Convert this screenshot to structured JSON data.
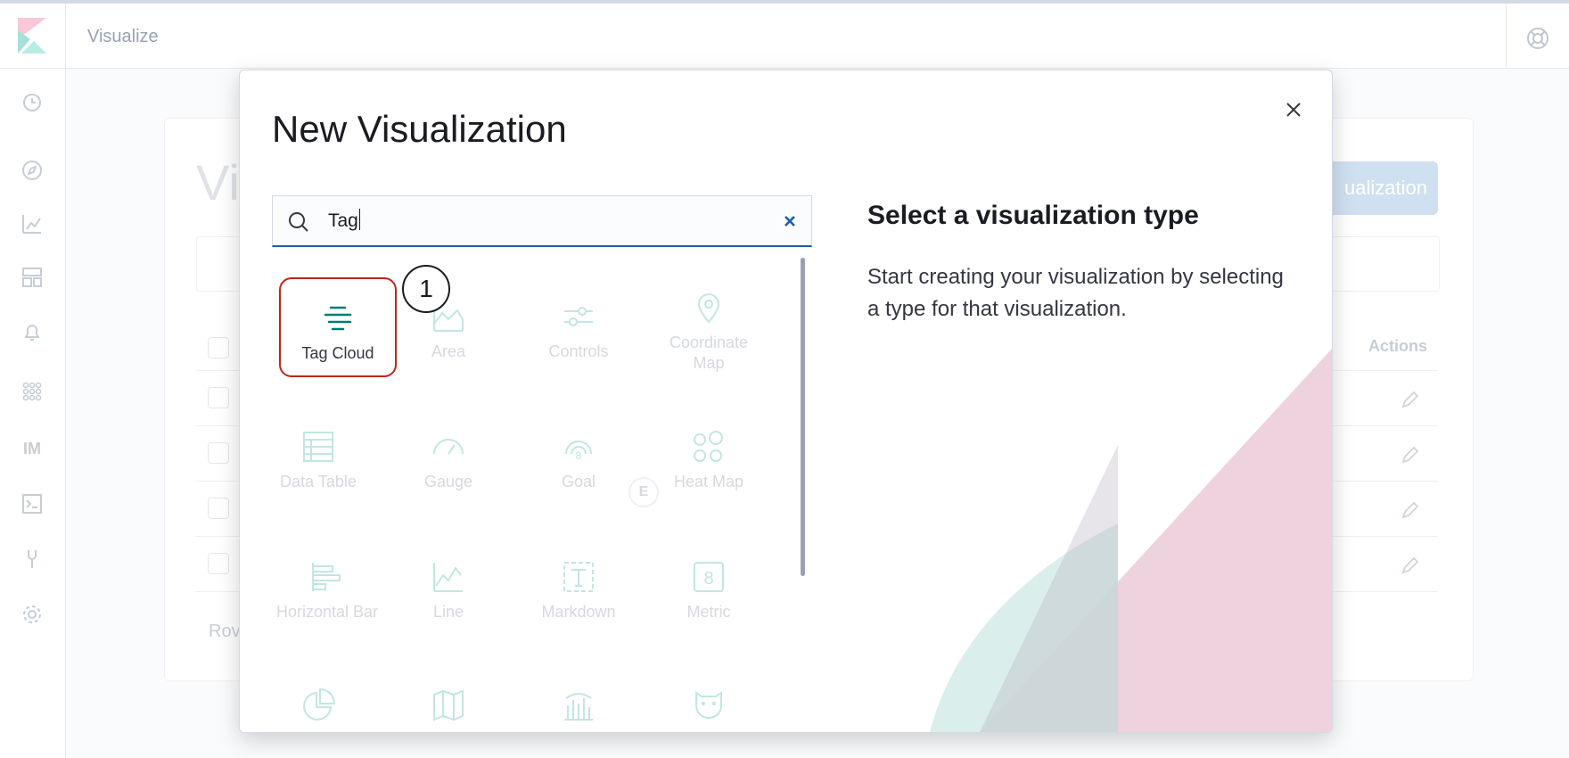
{
  "app": {
    "title": "Visualize",
    "help_icon": "help-icon",
    "logo_icon": "kibana-logo-icon"
  },
  "sidenav": {
    "items": [
      {
        "icon": "clock-icon"
      },
      {
        "icon": "compass-icon"
      },
      {
        "icon": "visualize-icon"
      },
      {
        "icon": "dashboard-icon"
      },
      {
        "icon": "bell-icon"
      },
      {
        "icon": "apps-icon"
      },
      {
        "icon": "im-icon",
        "text": "IM"
      },
      {
        "icon": "console-icon"
      },
      {
        "icon": "wrench-icon"
      },
      {
        "icon": "gear-icon"
      }
    ]
  },
  "background_page": {
    "title_fragment": "Vi",
    "create_button_fragment": "ualization",
    "actions_header": "Actions",
    "rows_label_fragment": "Rov"
  },
  "modal": {
    "title": "New Visualization",
    "close_icon": "close-icon",
    "search": {
      "value": "Tag",
      "icon": "search-icon",
      "clear_icon": "clear-icon"
    },
    "types": [
      {
        "label": "Tag Cloud",
        "icon": "tag-cloud-icon",
        "state": "enabled",
        "highlighted": true
      },
      {
        "label": "Area",
        "icon": "area-chart-icon",
        "state": "disabled"
      },
      {
        "label": "Controls",
        "icon": "controls-icon",
        "state": "disabled",
        "badge": "E"
      },
      {
        "label": "Coordinate Map",
        "icon": "map-pin-icon",
        "state": "disabled"
      },
      {
        "label": "Data Table",
        "icon": "table-icon",
        "state": "disabled"
      },
      {
        "label": "Gauge",
        "icon": "gauge-icon",
        "state": "disabled"
      },
      {
        "label": "Goal",
        "icon": "goal-icon",
        "state": "disabled"
      },
      {
        "label": "Heat Map",
        "icon": "heatmap-icon",
        "state": "disabled"
      },
      {
        "label": "Horizontal Bar",
        "icon": "horizontal-bar-icon",
        "state": "disabled"
      },
      {
        "label": "Line",
        "icon": "line-chart-icon",
        "state": "disabled"
      },
      {
        "label": "Markdown",
        "icon": "markdown-icon",
        "state": "disabled"
      },
      {
        "label": "Metric",
        "icon": "metric-icon",
        "state": "disabled"
      },
      {
        "label": "",
        "icon": "pie-chart-icon",
        "state": "disabled"
      },
      {
        "label": "",
        "icon": "region-map-icon",
        "state": "disabled"
      },
      {
        "label": "",
        "icon": "timeline-icon",
        "state": "disabled"
      },
      {
        "label": "",
        "icon": "vega-icon",
        "state": "disabled"
      }
    ],
    "annotation_number": "1",
    "side_panel": {
      "title": "Select a visualization type",
      "description": "Start creating your visualization by selecting a type for that visualization."
    }
  },
  "colors": {
    "accent": "#1f5fa6",
    "highlight_border": "#bd271e",
    "tag_cloud_icon": "#017d73",
    "disabled_icon": "#c2e6e2",
    "deco_pink": "#e8c4d4",
    "deco_teal": "#d4ece9"
  }
}
